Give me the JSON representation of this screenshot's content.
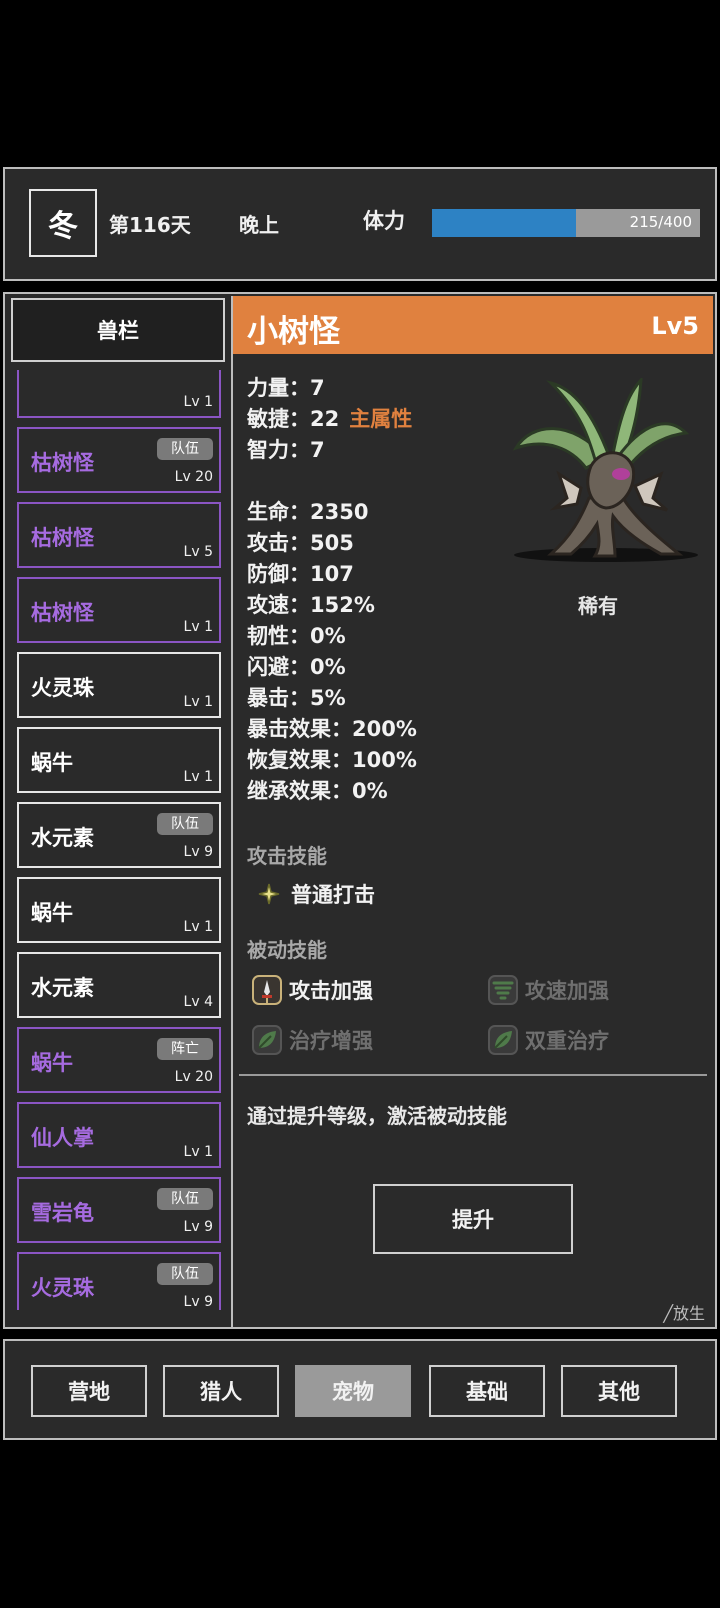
{
  "status": {
    "season": "冬",
    "day": "第116天",
    "time": "晚上",
    "stamina_label": "体力",
    "stamina_current": 215,
    "stamina_max": 400,
    "stamina_text": "215/400",
    "stamina_color": "#2d82c4"
  },
  "pet_list": {
    "header": "兽栏",
    "items": [
      {
        "name": "",
        "level": "Lv 1",
        "tag": "",
        "rarity": "purple"
      },
      {
        "name": "枯树怪",
        "level": "Lv 20",
        "tag": "队伍",
        "rarity": "purple"
      },
      {
        "name": "枯树怪",
        "level": "Lv 5",
        "tag": "",
        "rarity": "purple"
      },
      {
        "name": "枯树怪",
        "level": "Lv 1",
        "tag": "",
        "rarity": "purple"
      },
      {
        "name": "火灵珠",
        "level": "Lv 1",
        "tag": "",
        "rarity": "white"
      },
      {
        "name": "蜗牛",
        "level": "Lv 1",
        "tag": "",
        "rarity": "white"
      },
      {
        "name": "水元素",
        "level": "Lv 9",
        "tag": "队伍",
        "rarity": "white"
      },
      {
        "name": "蜗牛",
        "level": "Lv 1",
        "tag": "",
        "rarity": "white"
      },
      {
        "name": "水元素",
        "level": "Lv 4",
        "tag": "",
        "rarity": "white"
      },
      {
        "name": "蜗牛",
        "level": "Lv 20",
        "tag": "阵亡",
        "rarity": "purple"
      },
      {
        "name": "仙人掌",
        "level": "Lv 1",
        "tag": "",
        "rarity": "purple"
      },
      {
        "name": "雪岩龟",
        "level": "Lv 9",
        "tag": "队伍",
        "rarity": "purple"
      },
      {
        "name": "火灵珠",
        "level": "Lv 9",
        "tag": "队伍",
        "rarity": "purple"
      },
      {
        "name": "",
        "level": "",
        "tag": "",
        "rarity": "purple"
      }
    ]
  },
  "pet_detail": {
    "name": "小树怪",
    "level": "Lv5",
    "rarity": "稀有",
    "primary_attr_label": "主属性",
    "attributes": [
      {
        "text": "力量：7"
      },
      {
        "text": "敏捷：22"
      },
      {
        "text": "智力：7"
      }
    ],
    "stats": [
      {
        "text": "生命：2350"
      },
      {
        "text": "攻击：505"
      },
      {
        "text": "防御：107"
      },
      {
        "text": "攻速：152%"
      },
      {
        "text": "韧性：0%"
      },
      {
        "text": "闪避：0%"
      },
      {
        "text": "暴击：5%"
      },
      {
        "text": "暴击效果：200%"
      },
      {
        "text": "恢复效果：100%"
      },
      {
        "text": "继承效果：0%"
      }
    ],
    "attack_skills_title": "攻击技能",
    "attack_skills": [
      {
        "name": "普通打击",
        "icon": "sparkle-icon"
      }
    ],
    "passive_skills_title": "被动技能",
    "passive_skills": [
      {
        "name": "攻击加强",
        "icon": "sword-icon",
        "active": true
      },
      {
        "name": "攻速加强",
        "icon": "tornado-icon",
        "active": false
      },
      {
        "name": "治疗增强",
        "icon": "leaf-icon",
        "active": false
      },
      {
        "name": "双重治疗",
        "icon": "leaf-icon",
        "active": false
      }
    ],
    "hint": "通过提升等级，激活被动技能",
    "upgrade_label": "提升",
    "release_label": "╱放生"
  },
  "nav": {
    "tabs": [
      {
        "label": "营地",
        "active": false
      },
      {
        "label": "猎人",
        "active": false
      },
      {
        "label": "宠物",
        "active": true
      },
      {
        "label": "基础",
        "active": false
      },
      {
        "label": "其他",
        "active": false
      }
    ]
  },
  "colors": {
    "accent": "#e0813f",
    "purple_rarity": "#a66be0",
    "panel": "#2a2a2a"
  }
}
